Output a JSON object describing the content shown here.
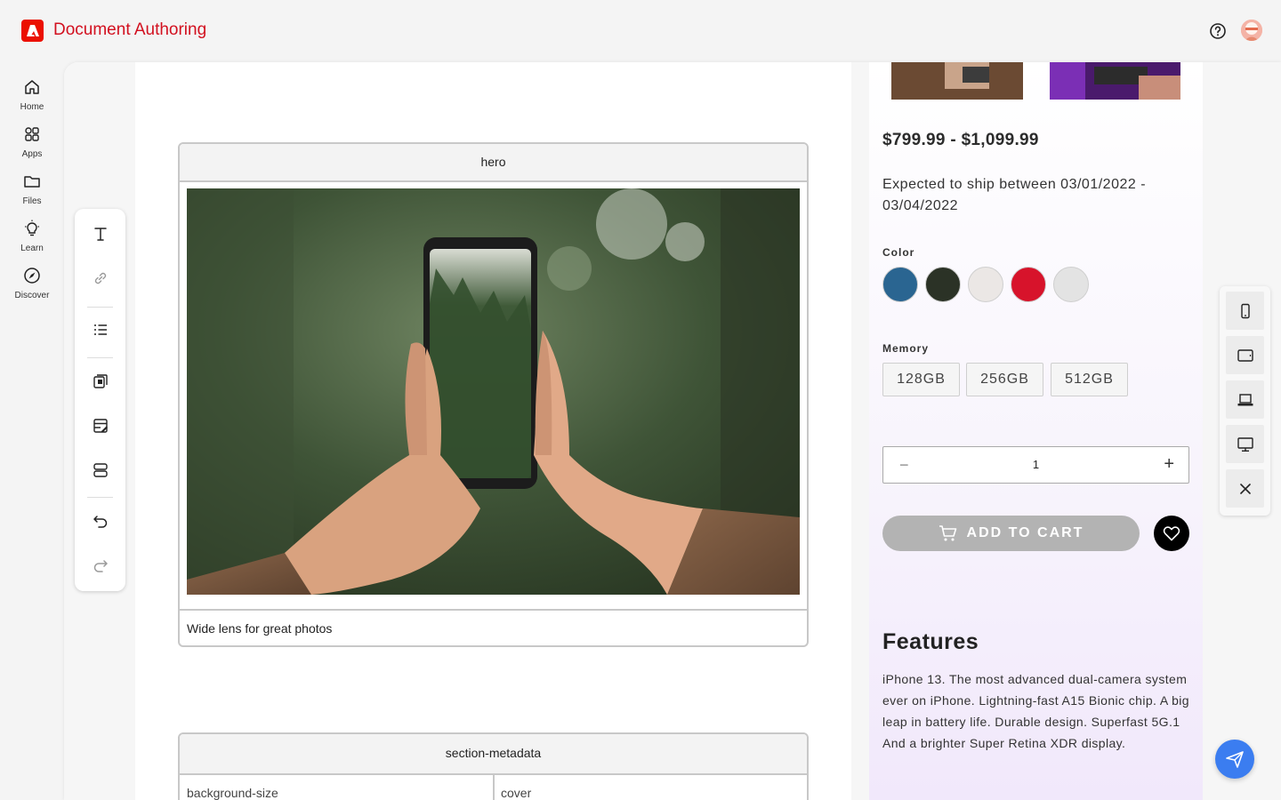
{
  "header": {
    "app_title": "Document Authoring",
    "brand_color": "#eb1000"
  },
  "rail": {
    "items": [
      {
        "label": "Home",
        "icon": "home-icon"
      },
      {
        "label": "Apps",
        "icon": "apps-icon"
      },
      {
        "label": "Files",
        "icon": "folder-icon"
      },
      {
        "label": "Learn",
        "icon": "lightbulb-icon"
      },
      {
        "label": "Discover",
        "icon": "compass-icon"
      }
    ]
  },
  "toolbar": {
    "tools": [
      "text-icon",
      "link-icon",
      "list-icon",
      "copy-block-icon",
      "edit-table-icon",
      "section-icon",
      "undo-icon",
      "redo-icon"
    ]
  },
  "document": {
    "hero_block": {
      "title": "hero",
      "caption": "Wide lens for great photos"
    },
    "metadata_block": {
      "title": "section-metadata",
      "rows": [
        {
          "key": "background-size",
          "value": "cover"
        }
      ]
    }
  },
  "preview": {
    "price": "$799.99 - $1,099.99",
    "shipping": "Expected to ship between 03/01/2022 - 03/04/2022",
    "color_label": "Color",
    "colors": [
      "#2a6591",
      "#2b3226",
      "#ebe7e5",
      "#d7132b",
      "#e3e3e3"
    ],
    "memory_label": "Memory",
    "memory_options": [
      "128GB",
      "256GB",
      "512GB"
    ],
    "quantity": "1",
    "add_to_cart_label": "ADD TO CART",
    "features_title": "Features",
    "features_text": "iPhone 13. The most advanced dual-camera system ever on iPhone. Lightning-fast A15 Bionic chip. A big leap in battery life. Durable design. Superfast 5G.1 And a brighter Super Retina XDR display."
  },
  "devices": [
    "phone-icon",
    "tablet-icon",
    "laptop-icon",
    "desktop-icon",
    "close-icon"
  ],
  "accent_color": "#3b7df0"
}
